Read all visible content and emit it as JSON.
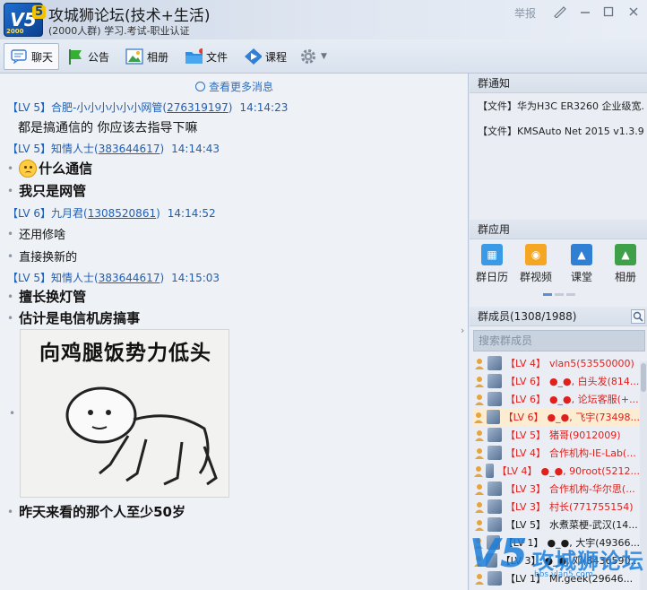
{
  "window": {
    "title": "攻城狮论坛(技术+生活)",
    "subtitle": "(2000人群) 学习.考试-职业认证",
    "report": "举报",
    "logo_text": "V5",
    "logo_badge": "5",
    "logo_year": "2000"
  },
  "toolbar": {
    "chat": "聊天",
    "notice": "公告",
    "album": "相册",
    "file": "文件",
    "course": "课程"
  },
  "chat": {
    "more_messages": "查看更多消息",
    "messages": [
      {
        "level": "【LV 5】",
        "name": "合肥-小小小小小小网管",
        "qq": "276319197",
        "time": "14:14:23",
        "lines": [
          "都是搞通信的 你应该去指导下嘛"
        ]
      },
      {
        "level": "【LV 5】",
        "name": "知情人士",
        "qq": "383644617",
        "time": "14:14:43",
        "lines": [
          "什么通信",
          "我只是网管"
        ]
      },
      {
        "level": "【LV 6】",
        "name": "九月君",
        "qq": "1308520861",
        "time": "14:14:52",
        "lines": [
          "还用修啥",
          "直接换新的"
        ]
      },
      {
        "level": "【LV 5】",
        "name": "知情人士",
        "qq": "383644617",
        "time": "14:15:03",
        "lines": [
          "擅长换灯管",
          "估计是电信机房搞事",
          "昨天来看的那个人至少50岁"
        ]
      }
    ],
    "meme_caption": "向鸡腿饭势力低头"
  },
  "right": {
    "notice_title": "群通知",
    "notices": [
      "【文件】华为H3C ER3260 企业级宽...",
      "【文件】KMSAuto Net 2015 v1.3.9 P..."
    ],
    "apps_title": "群应用",
    "apps": [
      "群日历",
      "群视频",
      "课堂",
      "相册"
    ],
    "members_title": "群成员(1308/1988)",
    "search_placeholder": "搜索群成员",
    "members": [
      {
        "level": "【LV 4】",
        "name": "vlan5(53550000)",
        "color": "#e0201c"
      },
      {
        "level": "【LV 6】",
        "name": "●_●, 白头发(814...",
        "color": "#e0201c"
      },
      {
        "level": "【LV 6】",
        "name": "●_●, 论坛客服(+...",
        "color": "#e0201c"
      },
      {
        "level": "【LV 6】",
        "name": "●_●, 飞宇(73498...",
        "color": "#e0201c"
      },
      {
        "level": "【LV 5】",
        "name": "猪哥(9012009)",
        "color": "#e0201c"
      },
      {
        "level": "【LV 4】",
        "name": "合作机构-IE-Lab(...",
        "color": "#e0201c"
      },
      {
        "level": "【LV 4】",
        "name": "●_●, 90root(5212...",
        "color": "#e0201c"
      },
      {
        "level": "【LV 3】",
        "name": "合作机构-华尔思(...",
        "color": "#e0201c"
      },
      {
        "level": "【LV 3】",
        "name": "村长(771755154)",
        "color": "#e0201c"
      },
      {
        "level": "【LV 5】",
        "name": "水煮菜梗-武汉(14...",
        "color": "#1a1a1a"
      },
      {
        "level": "【LV 1】",
        "name": "●_●, 大宇(49366...",
        "color": "#1a1a1a"
      },
      {
        "level": "【LV 3】",
        "name": "●_●, 邓(8436590...",
        "color": "#1a1a1a"
      },
      {
        "level": "【LV 1】",
        "name": "Mr.geek(29646...",
        "color": "#1a1a1a"
      }
    ],
    "watermark_text": "攻城狮论坛",
    "watermark_url": "bbs.vlan5.com"
  }
}
